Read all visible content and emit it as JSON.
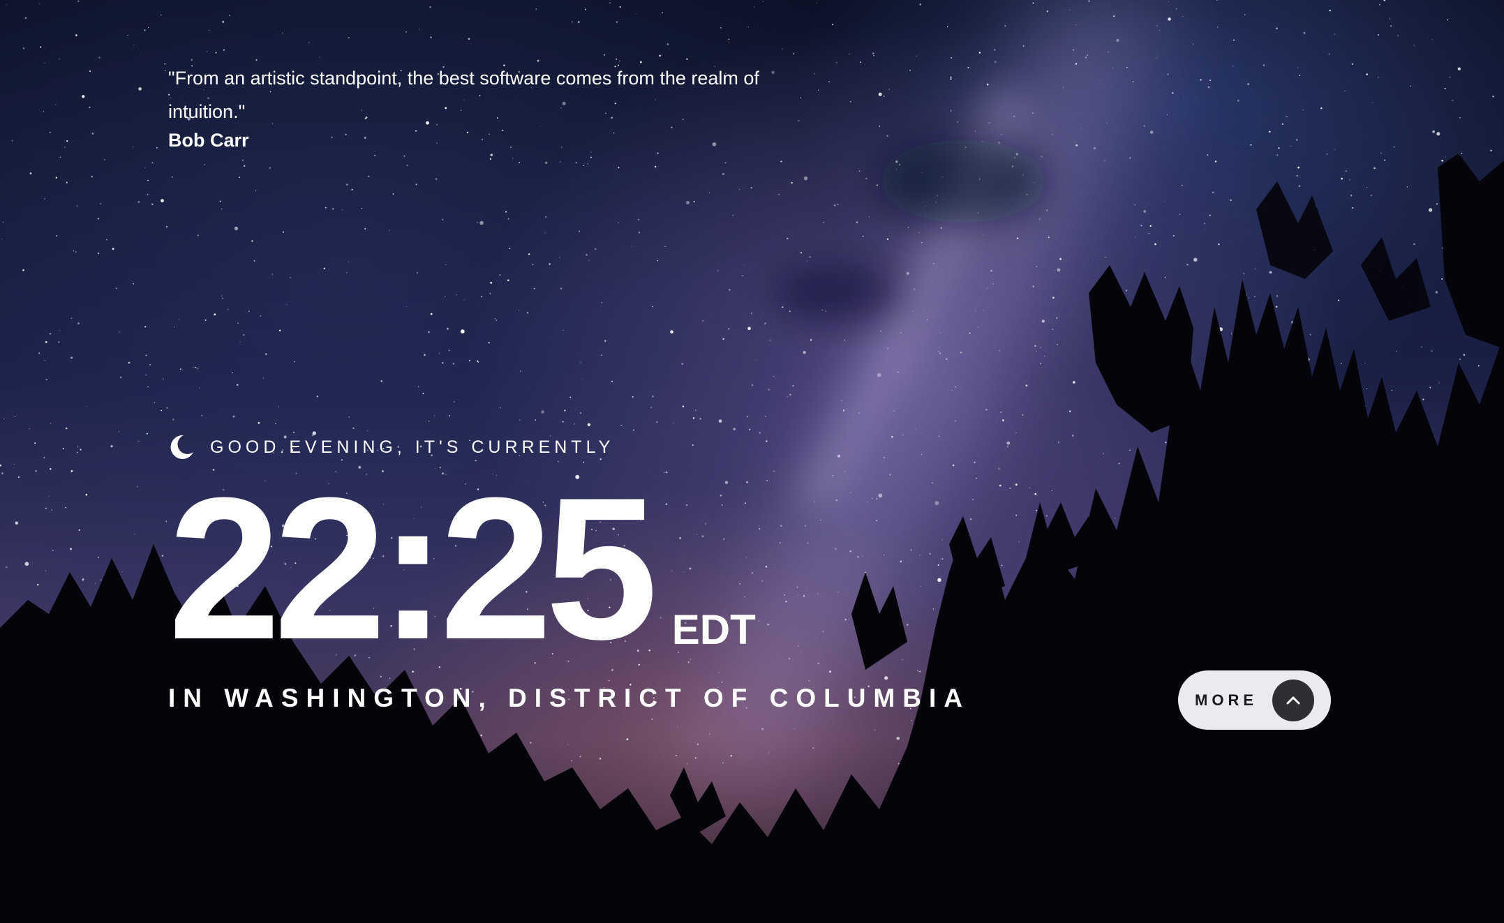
{
  "quote": {
    "text": "\"From an artistic standpoint, the best software comes from the realm of intuition.\"",
    "author": "Bob Carr"
  },
  "greeting": {
    "text": "GOOD EVENING, IT'S CURRENTLY",
    "icon": "moon-icon"
  },
  "clock": {
    "time": "22:25",
    "timezone": "EDT"
  },
  "location": {
    "text": "IN WASHINGTON, DISTRICT OF COLUMBIA"
  },
  "more_button": {
    "label": "MORE",
    "icon": "chevron-up-icon"
  },
  "colors": {
    "text": "#ffffff",
    "button_bg": "#eceaf0",
    "button_circle": "#2f2f33"
  }
}
